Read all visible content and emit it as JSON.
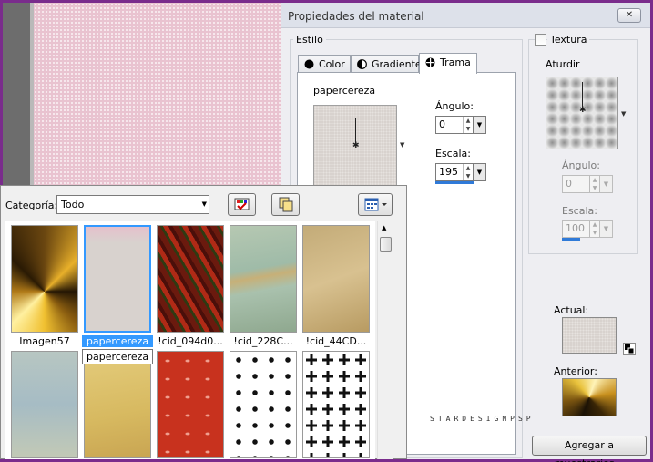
{
  "dialog": {
    "title": "Propiedades del material",
    "close_glyph": "✕",
    "estilo_label": "Estilo",
    "tabs": [
      {
        "label": "Color",
        "icon": "filled-circle-icon"
      },
      {
        "label": "Gradiente",
        "icon": "half-circle-icon"
      },
      {
        "label": "Trama",
        "icon": "pattern-icon",
        "active": true
      }
    ],
    "pattern_name": "papercereza",
    "angle": {
      "label": "Ángulo:",
      "value": "0"
    },
    "scale": {
      "label": "Escala:",
      "value": "195"
    },
    "texture": {
      "label": "Textura",
      "checked": false
    },
    "aturdir_label": "Aturdir",
    "texture_angle": {
      "label": "Ángulo:",
      "value": "0"
    },
    "texture_scale": {
      "label": "Escala:",
      "value": "100"
    },
    "actual_label": "Actual:",
    "anterior_label": "Anterior:",
    "add_button": "Agregar a muestrarios..."
  },
  "picker": {
    "category_label": "Categoría:",
    "category_value": "Todo",
    "tooltip": "papercereza",
    "patterns": [
      {
        "label": "Imagen57",
        "selected": false
      },
      {
        "label": "papercereza",
        "selected": true
      },
      {
        "label": "!cid_094d0...",
        "selected": false
      },
      {
        "label": "!cid_228C...",
        "selected": false
      },
      {
        "label": "!cid_44CD...",
        "selected": false
      }
    ]
  },
  "watermark": "STARDESIGNPSP",
  "colors": {
    "frame": "#7a2c8c",
    "selection": "#3399ff",
    "canvas": "#e9c3d0"
  }
}
